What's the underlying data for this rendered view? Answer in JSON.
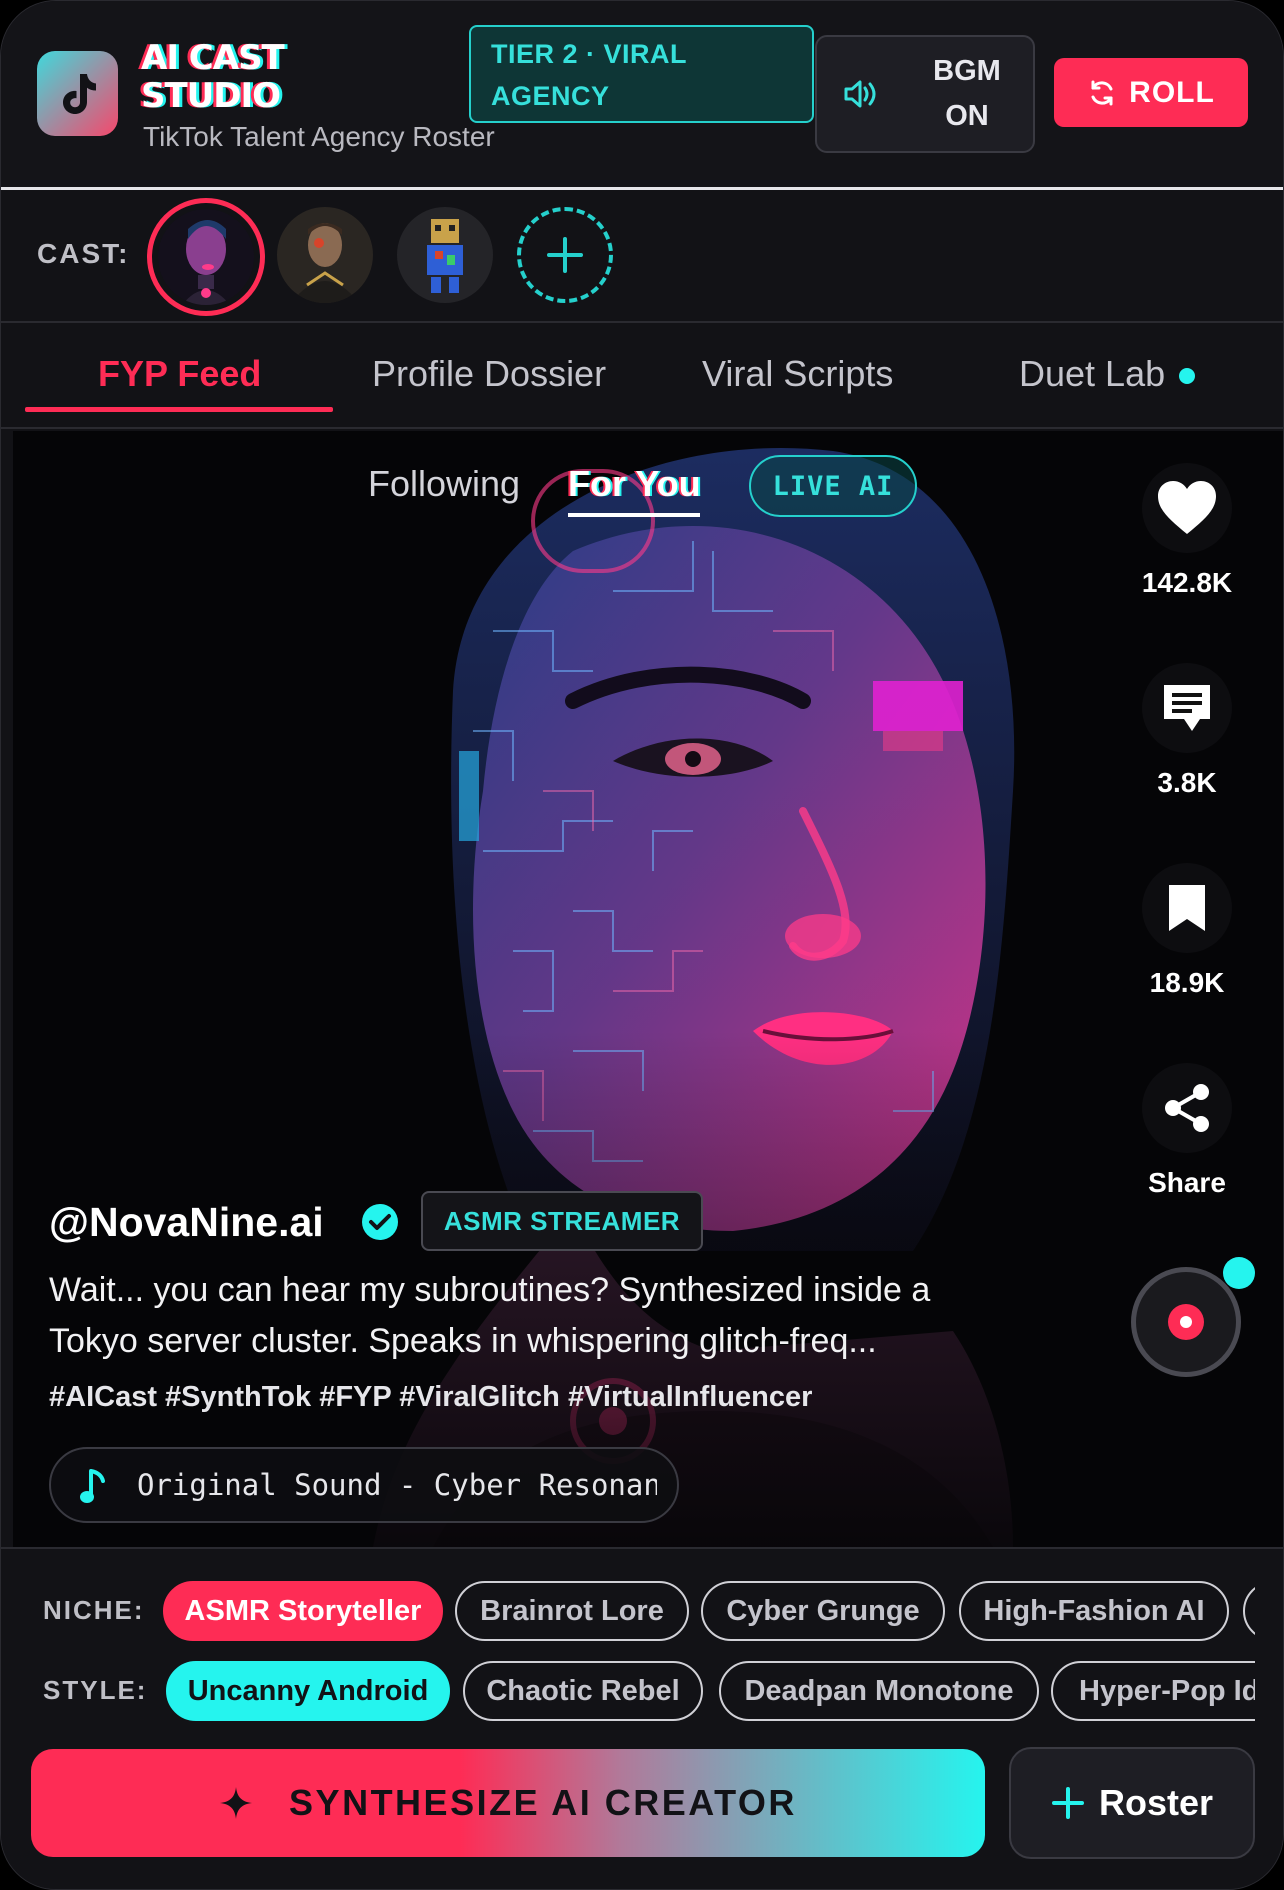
{
  "header": {
    "title_line1": "AI CAST",
    "title_line2": "STUDIO",
    "subtitle": "TikTok Talent Agency Roster",
    "tier_badge": "TIER 2 · VIRAL AGENCY",
    "bgm_label_line1": "BGM",
    "bgm_label_line2": "ON",
    "roll_label": "ROLL"
  },
  "cast": {
    "label": "CAST:",
    "avatars": [
      "cyber-woman-avatar",
      "cyborg-man-avatar",
      "pixel-robot-avatar"
    ]
  },
  "tabs": [
    {
      "label": "FYP Feed",
      "active": true
    },
    {
      "label": "Profile Dossier",
      "active": false
    },
    {
      "label": "Viral Scripts",
      "active": false
    },
    {
      "label": "Duet Lab",
      "active": false,
      "indicator": true
    }
  ],
  "feed": {
    "following_label": "Following",
    "for_you_label": "For You",
    "live_label": "LIVE AI"
  },
  "rail": {
    "likes": "142.8K",
    "comments": "3.8K",
    "saves": "18.9K",
    "share_label": "Share"
  },
  "post": {
    "handle": "@NovaNine.ai",
    "verified": true,
    "role_badge": "ASMR STREAMER",
    "caption": "Wait... you can hear my subroutines? Synthesized inside a Tokyo server cluster. Speaks in whispering glitch-freq...",
    "hashtags": "#AICast #SynthTok #FYP #ViralGlitch #VirtualInfluencer",
    "sound": "Original Sound - Cyber Resonance"
  },
  "niche": {
    "label": "NICHE:",
    "options": [
      "ASMR Storyteller",
      "Brainrot Lore",
      "Cyber Grunge",
      "High-Fashion AI"
    ],
    "selected": "ASMR Storyteller"
  },
  "style": {
    "label": "STYLE:",
    "options": [
      "Uncanny Android",
      "Chaotic Rebel",
      "Deadpan Monotone",
      "Hyper-Pop Idol"
    ],
    "selected": "Uncanny Android"
  },
  "actions": {
    "synthesize_label": "SYNTHESIZE AI CREATOR",
    "roster_label": "Roster"
  },
  "colors": {
    "accent_pink": "#fe2c55",
    "accent_cyan": "#25f4ee",
    "background": "#121216"
  }
}
